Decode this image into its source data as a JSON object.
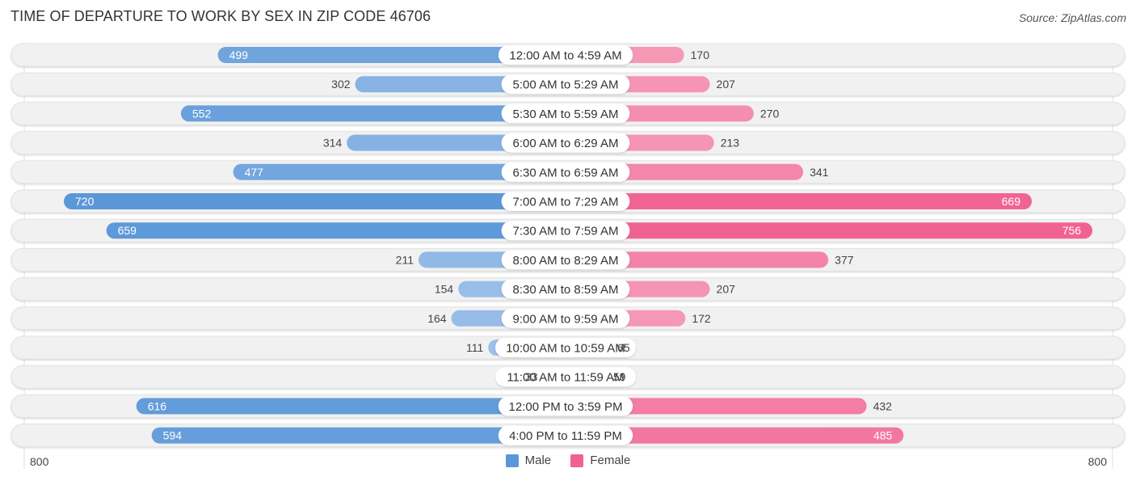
{
  "title": "TIME OF DEPARTURE TO WORK BY SEX IN ZIP CODE 46706",
  "source": "Source: ZipAtlas.com",
  "colors": {
    "male_strong": "#5b97d8",
    "male_light": "#a9c8ec",
    "female_strong": "#f06292",
    "female_light": "#f7aac2",
    "track": "#f1f1f1",
    "label_bg": "#ffffff"
  },
  "legend": [
    {
      "label": "Male",
      "color": "#5b97d8"
    },
    {
      "label": "Female",
      "color": "#f06292"
    }
  ],
  "axis": {
    "left_label": "800",
    "right_label": "800"
  },
  "chart_data": {
    "type": "bar",
    "orientation": "horizontal-diverging",
    "title": "TIME OF DEPARTURE TO WORK BY SEX IN ZIP CODE 46706",
    "categories": [
      "12:00 AM to 4:59 AM",
      "5:00 AM to 5:29 AM",
      "5:30 AM to 5:59 AM",
      "6:00 AM to 6:29 AM",
      "6:30 AM to 6:59 AM",
      "7:00 AM to 7:29 AM",
      "7:30 AM to 7:59 AM",
      "8:00 AM to 8:29 AM",
      "8:30 AM to 8:59 AM",
      "9:00 AM to 9:59 AM",
      "10:00 AM to 10:59 AM",
      "11:00 AM to 11:59 AM",
      "12:00 PM to 3:59 PM",
      "4:00 PM to 11:59 PM"
    ],
    "series": [
      {
        "name": "Male",
        "side": "left",
        "values": [
          499,
          302,
          552,
          314,
          477,
          720,
          659,
          211,
          154,
          164,
          111,
          33,
          616,
          594
        ]
      },
      {
        "name": "Female",
        "side": "right",
        "values": [
          170,
          207,
          270,
          213,
          341,
          669,
          756,
          377,
          207,
          172,
          65,
          59,
          432,
          485
        ]
      }
    ],
    "xlim": [
      -800,
      800
    ],
    "xtick_labels": [
      "800",
      "800"
    ],
    "legend_position": "bottom-center",
    "grid": false
  }
}
